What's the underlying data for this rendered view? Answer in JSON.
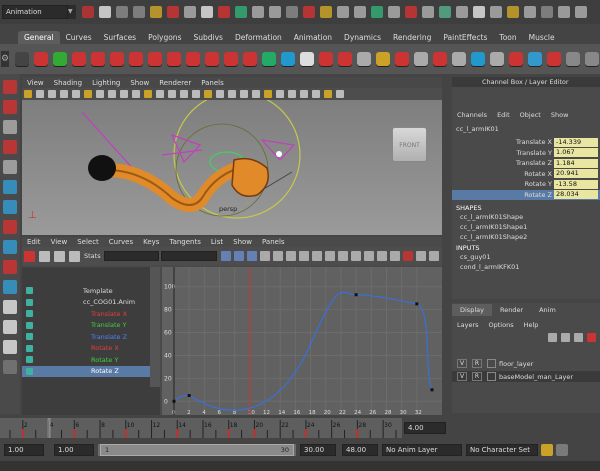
{
  "status_line": {
    "mode_select": "Animation"
  },
  "shelf_tabs": [
    "General",
    "Curves",
    "Surfaces",
    "Polygons",
    "Subdivs",
    "Deformation",
    "Animation",
    "Dynamics",
    "Rendering",
    "PaintEffects",
    "Toon",
    "Muscle"
  ],
  "viewport": {
    "menus": [
      "View",
      "Shading",
      "Lighting",
      "Show",
      "Renderer",
      "Panels"
    ],
    "cube_label": "FRONT",
    "camera_label": "persp"
  },
  "graph_editor": {
    "menus": [
      "Edit",
      "View",
      "Select",
      "Curves",
      "Keys",
      "Tangents",
      "List",
      "Show",
      "Panels"
    ],
    "stats_label": "Stats",
    "outliner_items": [
      {
        "label": "Template",
        "color": "#dddddd"
      },
      {
        "label": "cc_COG01.Anim",
        "color": "#dddddd"
      },
      {
        "label": "Translate X",
        "color": "#e04040"
      },
      {
        "label": "Translate Y",
        "color": "#40d040"
      },
      {
        "label": "Translate Z",
        "color": "#5080ff"
      },
      {
        "label": "Rotate X",
        "color": "#e04040"
      },
      {
        "label": "Rotate Y",
        "color": "#40d040"
      },
      {
        "label": "Rotate Z",
        "color": "#ffffff"
      }
    ],
    "y_ticks": [
      "100",
      "80",
      "60",
      "40",
      "20",
      "0"
    ],
    "x_ticks": [
      "0",
      "2",
      "4",
      "6",
      "8",
      "10",
      "12",
      "14",
      "16",
      "18",
      "20",
      "22",
      "24",
      "26",
      "28",
      "30",
      "32"
    ],
    "curve_keys": [
      [
        0,
        0
      ],
      [
        2,
        5
      ],
      [
        24,
        93
      ],
      [
        32,
        85
      ],
      [
        34,
        10
      ]
    ]
  },
  "channel_box": {
    "header": "Channel Box / Layer Editor",
    "menus": [
      "Channels",
      "Edit",
      "Object",
      "Show"
    ],
    "object_name": "cc_l_armIK01",
    "channels": [
      {
        "name": "Translate X",
        "value": "-14.339"
      },
      {
        "name": "Translate Y",
        "value": "1.067"
      },
      {
        "name": "Translate Z",
        "value": "1.184"
      },
      {
        "name": "Rotate X",
        "value": "20.941"
      },
      {
        "name": "Rotate Y",
        "value": "-13.58"
      },
      {
        "name": "Rotate Z",
        "value": "28.034"
      }
    ],
    "shapes_title": "SHAPES",
    "shapes": [
      "cc_l_armIK01Shape",
      "cc_l_armIK01Shape1",
      "cc_l_armIK01Shape2"
    ],
    "inputs_title": "INPUTS",
    "inputs": [
      "cs_guy01",
      "cond_l_armIKFK01"
    ]
  },
  "layer_editor": {
    "tabs": [
      "Display",
      "Render",
      "Anim"
    ],
    "menus": [
      "Layers",
      "Options",
      "Help"
    ],
    "layers": [
      {
        "v": "V",
        "r": "R",
        "name": "floor_layer"
      },
      {
        "v": "V",
        "r": "R",
        "name": "baseModel_man_Layer"
      }
    ]
  },
  "timeline": {
    "ticks": [
      "2",
      "4",
      "6",
      "8",
      "10",
      "12",
      "14",
      "16",
      "18",
      "20",
      "22",
      "24",
      "26",
      "28",
      "30"
    ],
    "current_frame": "4.00"
  },
  "range_bar": {
    "start": "1.00",
    "inner_start": "1.00",
    "slider_start": "1",
    "slider_end": "30",
    "end": "30.00",
    "outer_end": "48.00",
    "anim_layer": "No Anim Layer",
    "char_set": "No Character Set"
  }
}
